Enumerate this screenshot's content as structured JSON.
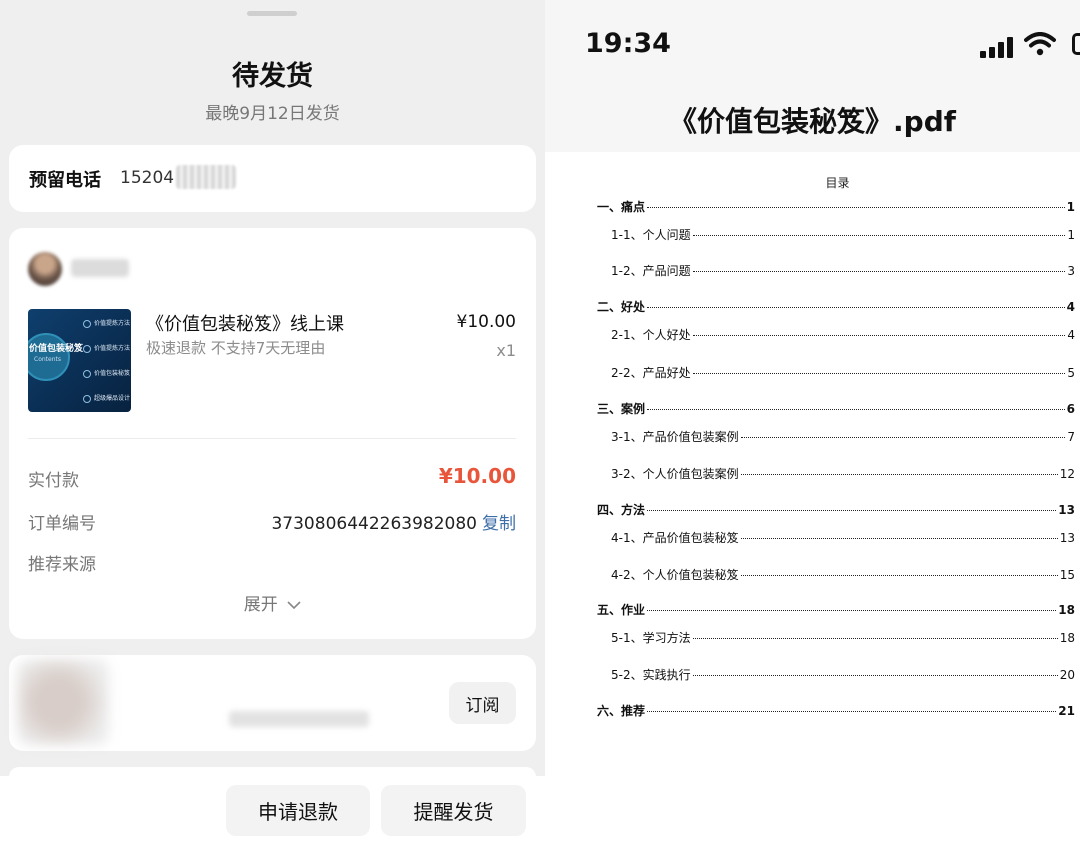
{
  "order_sheet": {
    "title": "待发货",
    "subtitle": "最晚9月12日发货",
    "phone": {
      "label": "预留电话",
      "value": "15204"
    },
    "product": {
      "thumbnail": {
        "title": "价值包装秘笈",
        "sub": "Contents",
        "rows": [
          "价值提炼方法",
          "价值提炼方法",
          "价值包装秘笈",
          "超级爆品设计"
        ]
      },
      "name": "《价值包装秘笈》线上课",
      "tags": "极速退款 不支持7天无理由",
      "price": "¥10.00",
      "qty": "x1"
    },
    "rows": {
      "paid_label": "实付款",
      "paid_value": "¥10.00",
      "order_no_label": "订单编号",
      "order_no_value": "3730806442263982080",
      "copy_label": "复制",
      "source_label": "推荐来源"
    },
    "expand_label": "展开",
    "recommend": {
      "subscribe_label": "订阅"
    },
    "actions": {
      "refund": "申请退款",
      "remind": "提醒发货"
    }
  },
  "pdf_viewer": {
    "time": "19:34",
    "title": "《价值包装秘笈》.pdf",
    "toc_title": "目录",
    "toc": [
      {
        "label": "一、痛点",
        "page": "1",
        "level": 1
      },
      {
        "label": "1-1、个人问题",
        "page": "1",
        "level": 2
      },
      {
        "label": "1-2、产品问题",
        "page": "3",
        "level": 2
      },
      {
        "label": "二、好处",
        "page": "4",
        "level": 1
      },
      {
        "label": "2-1、个人好处",
        "page": "4",
        "level": 2
      },
      {
        "label": "2-2、产品好处",
        "page": "5",
        "level": 2
      },
      {
        "label": "三、案例",
        "page": "6",
        "level": 1
      },
      {
        "label": "3-1、产品价值包装案例",
        "page": "7",
        "level": 2
      },
      {
        "label": "3-2、个人价值包装案例",
        "page": "12",
        "level": 2
      },
      {
        "label": "四、方法",
        "page": "13",
        "level": 1
      },
      {
        "label": "4-1、产品价值包装秘笈",
        "page": "13",
        "level": 2
      },
      {
        "label": "4-2、个人价值包装秘笈",
        "page": "15",
        "level": 2
      },
      {
        "label": "五、作业",
        "page": "18",
        "level": 1
      },
      {
        "label": "5-1、学习方法",
        "page": "18",
        "level": 2
      },
      {
        "label": "5-2、实践执行",
        "page": "20",
        "level": 2
      },
      {
        "label": "六、推荐",
        "page": "21",
        "level": 1
      }
    ]
  },
  "colors": {
    "price_red": "#e8553a",
    "link_blue": "#3c6ea8"
  },
  "icons": [
    "chevron-down-icon",
    "signal-icon",
    "wifi-icon",
    "battery-icon"
  ]
}
